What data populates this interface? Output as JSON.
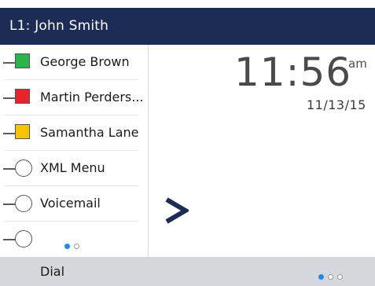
{
  "header": {
    "line_label": "L1: John Smith"
  },
  "sidebar": {
    "keys": [
      {
        "label": "George Brown",
        "indicator": "square",
        "color": "#2db34a"
      },
      {
        "label": "Martin Perders...",
        "indicator": "square",
        "color": "#e8232a"
      },
      {
        "label": "Samantha Lane",
        "indicator": "square",
        "color": "#f6c400"
      },
      {
        "label": "XML Menu",
        "indicator": "circle"
      },
      {
        "label": "Voicemail",
        "indicator": "circle"
      },
      {
        "label": "",
        "indicator": "circle"
      }
    ],
    "page_indicator": {
      "pages": 2,
      "current": 1
    }
  },
  "clock": {
    "time": "11:56",
    "ampm": "am",
    "date": "11/13/15"
  },
  "softkeys": {
    "dial_label": "Dial",
    "page_indicator": {
      "pages": 3,
      "current": 1
    }
  },
  "colors": {
    "header_bg": "#1c2c57",
    "accent": "#1b8ef2",
    "softbar_bg": "#d4d7dc"
  }
}
